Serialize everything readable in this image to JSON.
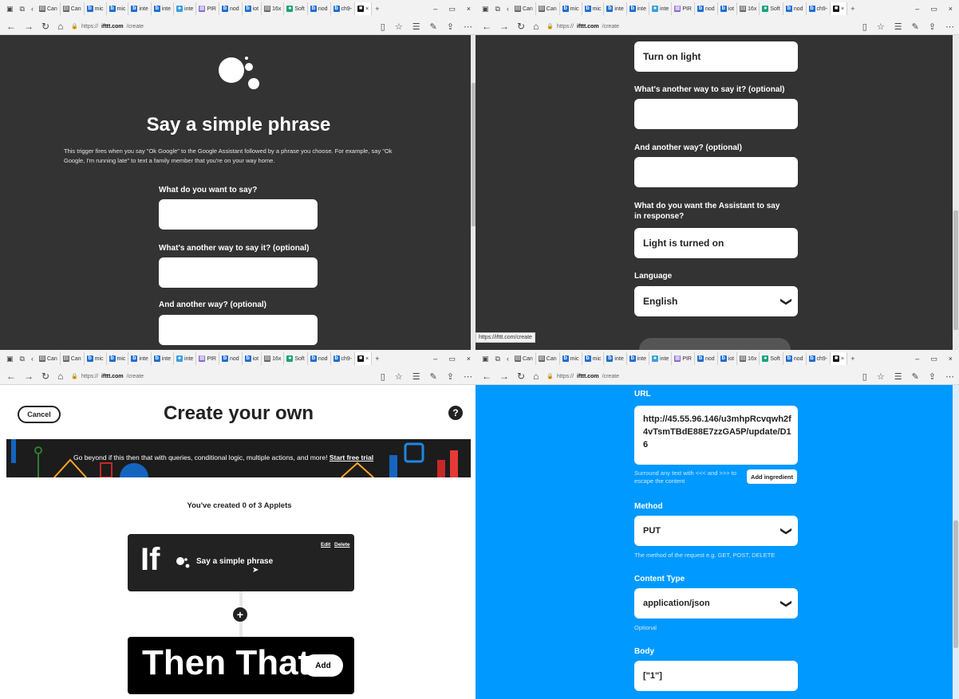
{
  "browser": {
    "tabs_short": [
      "Can",
      "Can",
      "mic",
      "mic",
      "inte",
      "inte",
      "inte",
      "PIR",
      "nod",
      "iot",
      "16x",
      "Soft",
      "nod",
      "ch9-"
    ],
    "address_prefix": "https://",
    "address_domain": "ifttt.com",
    "address_path": "/create",
    "status_url": "https://ifttt.com/create"
  },
  "trigger_intro": {
    "title": "Say a simple phrase",
    "description": "This trigger fires when you say \"Ok Google\" to the Google Assistant followed by a phrase you choose. For example, say \"Ok Google, I'm running late\" to text a family member that you're on your way home.",
    "field1_label": "What do you want to say?",
    "field1_value": "",
    "field2_label": "What's another way to say it? (optional)",
    "field2_value": "",
    "field3_label": "And another way? (optional)",
    "field3_value": ""
  },
  "trigger_filled": {
    "field1_value": "Turn on light",
    "field2_label": "What's another way to say it? (optional)",
    "field2_value": "",
    "field3_label": "And another way? (optional)",
    "field3_value": "",
    "response_label": "What do you want the Assistant to say in response?",
    "response_value": "Light is turned on",
    "language_label": "Language",
    "language_value": "English"
  },
  "create": {
    "cancel_label": "Cancel",
    "title": "Create your own",
    "help_icon": "question-circle-icon",
    "banner_text": "Go beyond if this then that with queries, conditional logic, multiple actions, and more!",
    "banner_link": "Start free trial",
    "applet_count": "You've created 0 of 3 Applets",
    "if_label": "If",
    "if_service": "Say a simple phrase",
    "edit_label": "Edit",
    "delete_label": "Delete",
    "then_label": "Then That",
    "add_label": "Add"
  },
  "webhook": {
    "url_label": "URL",
    "url_value": "http://45.55.96.146/u3mhpRcvqwh2f4vTsmTBdE88E7zzGA5P/update/D16",
    "url_help": "Surround any text with <<< and >>> to escape the content",
    "add_ingredient": "Add ingredient",
    "method_label": "Method",
    "method_value": "PUT",
    "method_help": "The method of the request e.g. GET, POST, DELETE",
    "content_type_label": "Content Type",
    "content_type_value": "application/json",
    "content_type_help": "Optional",
    "body_label": "Body",
    "body_value": "[\"1\"]"
  },
  "colors": {
    "dark_bg": "#333333",
    "webhook_blue": "#0099ff",
    "white": "#ffffff"
  }
}
